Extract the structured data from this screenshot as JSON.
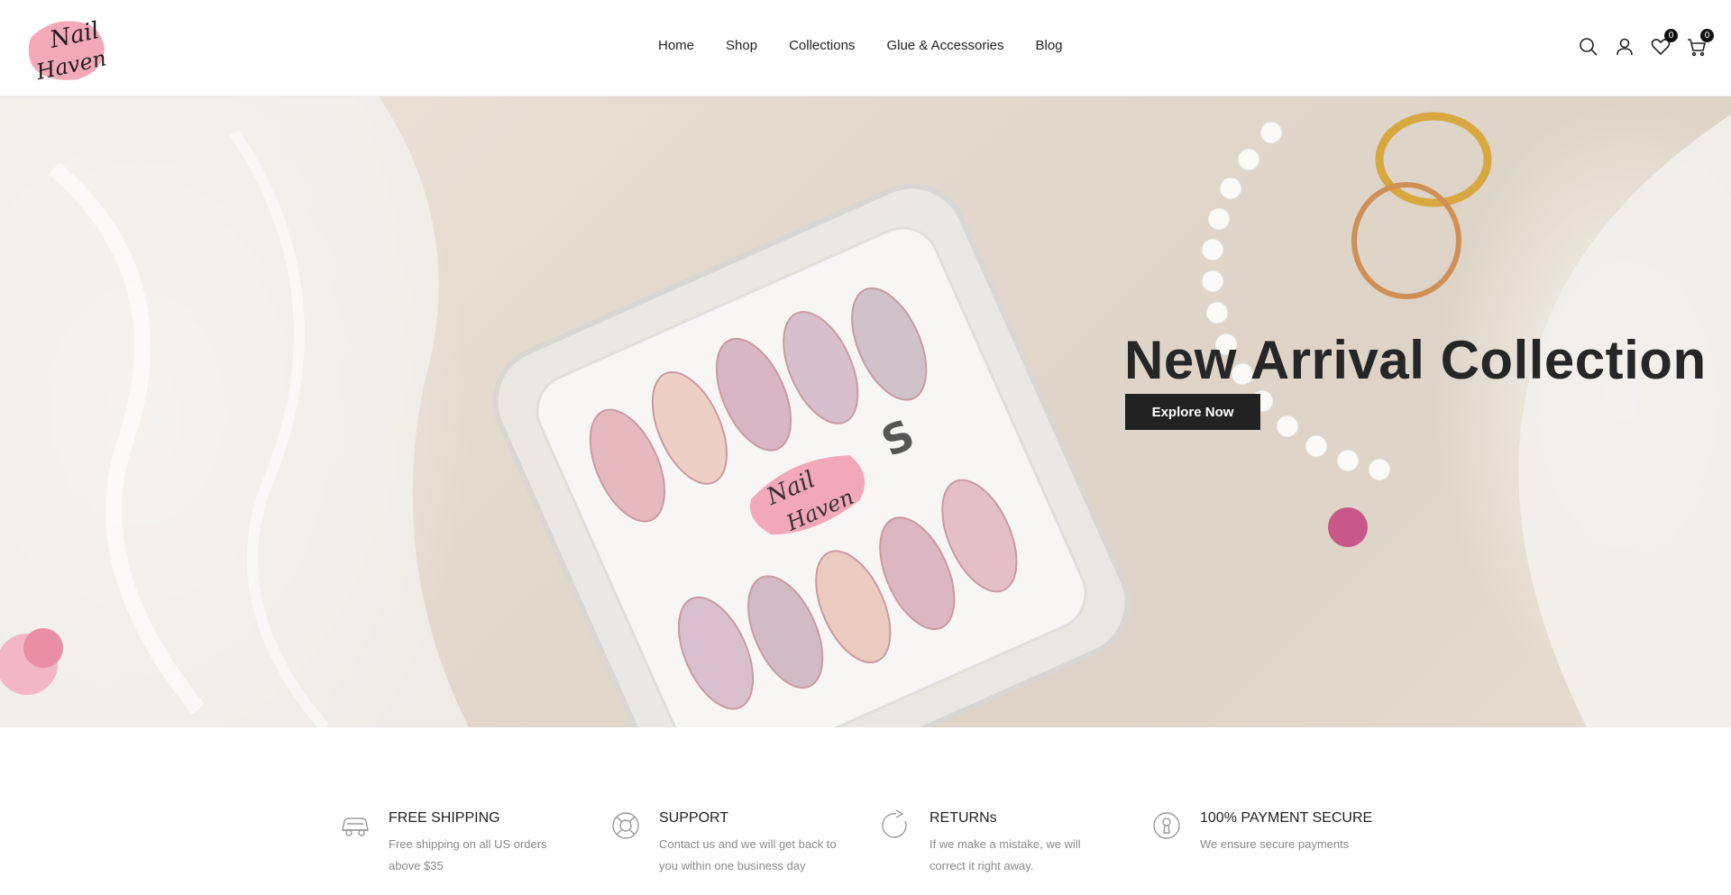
{
  "brand": {
    "logo_line1": "Nail",
    "logo_line2": "Haven",
    "logo_bg": "#f4a9b8"
  },
  "nav": {
    "items": [
      {
        "label": "Home"
      },
      {
        "label": "Shop"
      },
      {
        "label": "Collections"
      },
      {
        "label": "Glue & Accessories"
      },
      {
        "label": "Blog"
      }
    ]
  },
  "header_icons": {
    "search": "search-icon",
    "account": "user-icon",
    "wishlist": "heart-icon",
    "wishlist_count": "0",
    "cart": "cart-icon",
    "cart_count": "0"
  },
  "hero": {
    "title": "New Arrival Collection",
    "cta_label": "Explore Now",
    "card_logo_line1": "Nail",
    "card_logo_line2": "Haven",
    "card_size": "S"
  },
  "features": [
    {
      "icon": "truck-icon",
      "title": "FREE SHIPPING",
      "desc": "Free shipping on all US orders above $35"
    },
    {
      "icon": "lifebuoy-icon",
      "title": "SUPPORT",
      "desc": "Contact us and we will get back to you within one business day"
    },
    {
      "icon": "refresh-icon",
      "title": "RETURNs",
      "desc": "If we make a mistake, we will correct it right away."
    },
    {
      "icon": "keyhole-icon",
      "title": "100% PAYMENT SECURE",
      "desc": "We ensure secure payments"
    }
  ]
}
